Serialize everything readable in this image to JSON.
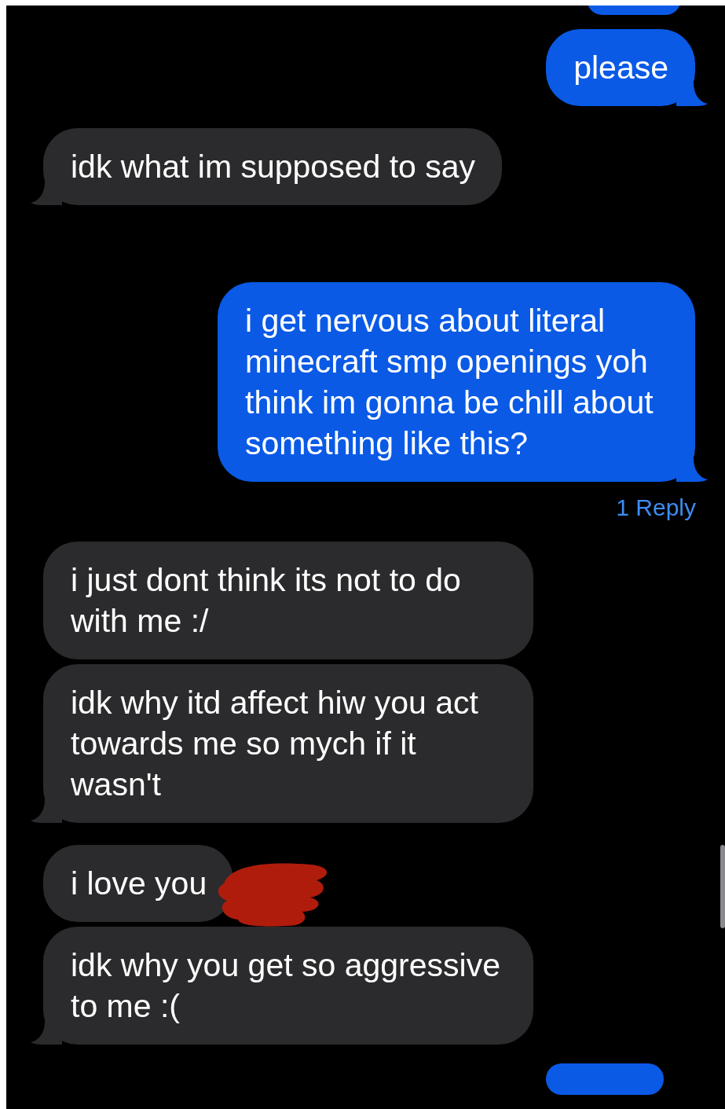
{
  "messages": [
    {
      "kind": "partial-sent"
    },
    {
      "kind": "sent",
      "text": "please",
      "tail": true
    },
    {
      "kind": "received",
      "text": "idk what im supposed to say",
      "tail": true
    },
    {
      "kind": "sent",
      "text": "i get nervous about literal minecraft smp openings yoh think im gonna be chill about something like this?",
      "tail": true,
      "reply_link": "1 Reply"
    },
    {
      "kind": "received",
      "text": "i just dont think its not to do with me :/",
      "tail": false
    },
    {
      "kind": "received",
      "text": "idk why itd affect hiw you act towards me so mych if it wasn't",
      "tail": true
    },
    {
      "kind": "received",
      "text": "i love you",
      "tail": false,
      "redacted": true
    },
    {
      "kind": "received",
      "text": "idk why you get so aggressive to me :(",
      "tail": true
    },
    {
      "kind": "partial-sent"
    }
  ]
}
